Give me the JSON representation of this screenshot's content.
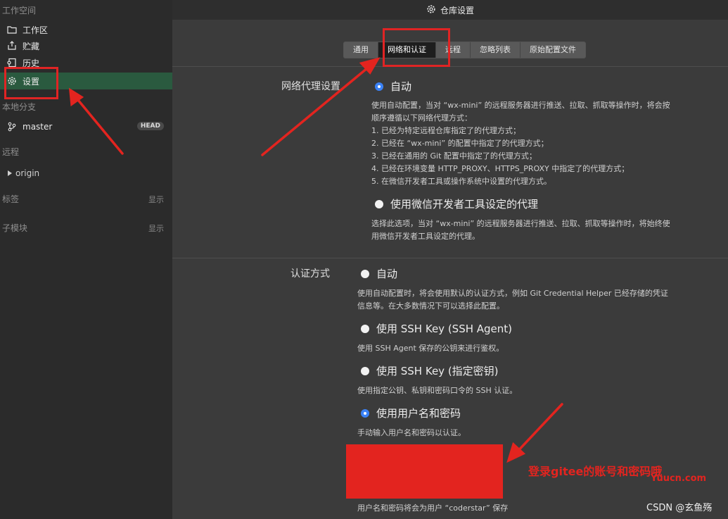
{
  "window": {
    "title": "仓库设置"
  },
  "sidebar": {
    "workspace_title": "工作空间",
    "items": [
      {
        "label": "工作区",
        "icon": "folder-icon"
      },
      {
        "label": "贮藏",
        "icon": "stash-icon"
      },
      {
        "label": "历史",
        "icon": "history-icon"
      },
      {
        "label": "设置",
        "icon": "gear-icon",
        "active": true
      }
    ],
    "local_branch_title": "本地分支",
    "branch": {
      "name": "master",
      "badge": "HEAD"
    },
    "remote_title": "远程",
    "remote": {
      "name": "origin"
    },
    "tags_title": "标签",
    "tags_show": "显示",
    "submodules_title": "子模块",
    "submodules_show": "显示"
  },
  "tabs": [
    {
      "label": "通用"
    },
    {
      "label": "网络和认证",
      "active": true
    },
    {
      "label": "远程"
    },
    {
      "label": "忽略列表"
    },
    {
      "label": "原始配置文件"
    }
  ],
  "proxy": {
    "heading": "网络代理设置",
    "auto_label": "自动",
    "auto_desc": [
      "使用自动配置，当对 “wx-mini” 的远程服务器进行推送、拉取、抓取等操作时，将会按",
      "顺序遵循以下网络代理方式：",
      "1. 已经为特定远程仓库指定了的代理方式；",
      "2. 已经在 “wx-mini” 的配置中指定了的代理方式；",
      "3. 已经在通用的 Git 配置中指定了的代理方式；",
      "4. 已经在环境变量 HTTP_PROXY、HTTPS_PROXY 中指定了的代理方式；",
      "5. 在微信开发者工具或操作系统中设置的代理方式。"
    ],
    "wechat_label": "使用微信开发者工具设定的代理",
    "wechat_desc": [
      "选择此选项，当对 “wx-mini” 的远程服务器进行推送、拉取、抓取等操作时，将始终使",
      "用微信开发者工具设定的代理。"
    ]
  },
  "auth": {
    "heading": "认证方式",
    "options": [
      {
        "label": "自动",
        "checked": false,
        "desc": [
          "使用自动配置时，将会使用默认的认证方式，例如 Git Credential Helper 已经存储的凭证",
          "信息等。在大多数情况下可以选择此配置。"
        ]
      },
      {
        "label": "使用 SSH Key (SSH Agent)",
        "checked": false,
        "desc": [
          "使用 SSH Agent 保存的公钥来进行鉴权。"
        ]
      },
      {
        "label": "使用 SSH Key (指定密钥)",
        "checked": false,
        "desc": [
          "使用指定公钥、私钥和密码口令的 SSH 认证。"
        ]
      },
      {
        "label": "使用用户名和密码",
        "checked": true,
        "desc": [
          "手动输入用户名和密码以认证。"
        ]
      }
    ],
    "save_note": "用户名和密码将会为用户 “coderstar” 保存"
  },
  "annotation": {
    "text": "登录gitee的账号和密码哦",
    "color": "#e3241f"
  },
  "watermarks": {
    "yuucn": "Yuucn.com",
    "csdn": "CSDN @玄鱼殇"
  }
}
